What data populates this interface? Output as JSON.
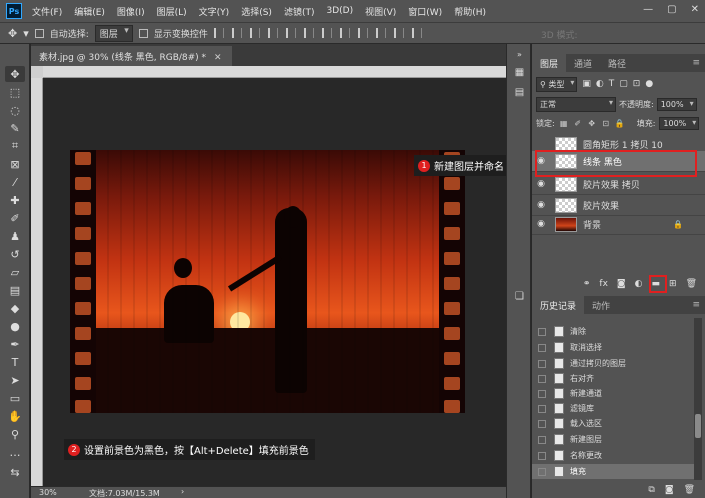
{
  "app": {
    "logo": "Ps"
  },
  "menu": [
    "文件(F)",
    "编辑(E)",
    "图像(I)",
    "图层(L)",
    "文字(Y)",
    "选择(S)",
    "滤镜(T)",
    "3D(D)",
    "视图(V)",
    "窗口(W)",
    "帮助(H)"
  ],
  "window_controls": [
    "—",
    "▢",
    "✕"
  ],
  "options": {
    "auto_select_label": "自动选择:",
    "auto_select_value": "图层",
    "show_transform_label": "显示变换控件",
    "mode_3d_label": "3D 模式:"
  },
  "document": {
    "tab_title": "素材.jpg @ 30% (线条 黑色, RGB/8#) *",
    "zoom": "30%",
    "doc_size": "文档:7.03M/15.3M"
  },
  "callouts": [
    {
      "number": "1",
      "text": "新建图层并命名"
    },
    {
      "number": "2",
      "text": "设置前景色为黑色，按【Alt+Delete】填充前景色"
    }
  ],
  "layers_panel": {
    "tabs": [
      "图层",
      "通道",
      "路径"
    ],
    "filter_label": "类型",
    "blend_mode": "正常",
    "opacity_label": "不透明度:",
    "opacity_value": "100%",
    "lock_label": "锁定:",
    "fill_label": "填充:",
    "fill_value": "100%",
    "layers": [
      {
        "name": "圆角矩形 1 拷贝 10",
        "visible": false,
        "selected": false,
        "thumb": "transparent"
      },
      {
        "name": "线条 黑色",
        "visible": true,
        "selected": true,
        "thumb": "transparent"
      },
      {
        "name": "胶片效果 拷贝",
        "visible": true,
        "selected": false,
        "thumb": "transparent"
      },
      {
        "name": "胶片效果",
        "visible": true,
        "selected": false,
        "thumb": "transparent"
      },
      {
        "name": "背景",
        "visible": true,
        "selected": false,
        "thumb": "photo",
        "locked": true
      }
    ]
  },
  "history_panel": {
    "tabs": [
      "历史记录",
      "动作"
    ],
    "items": [
      "清除",
      "取消选择",
      "通过拷贝的图层",
      "右对齐",
      "新建通道",
      "滤镜库",
      "载入选区",
      "新建图层",
      "名称更改",
      "填充"
    ],
    "current_index": 9
  },
  "colors": {
    "foreground": "#000000",
    "background": "#ffffff",
    "accent_red": "#e02020"
  }
}
